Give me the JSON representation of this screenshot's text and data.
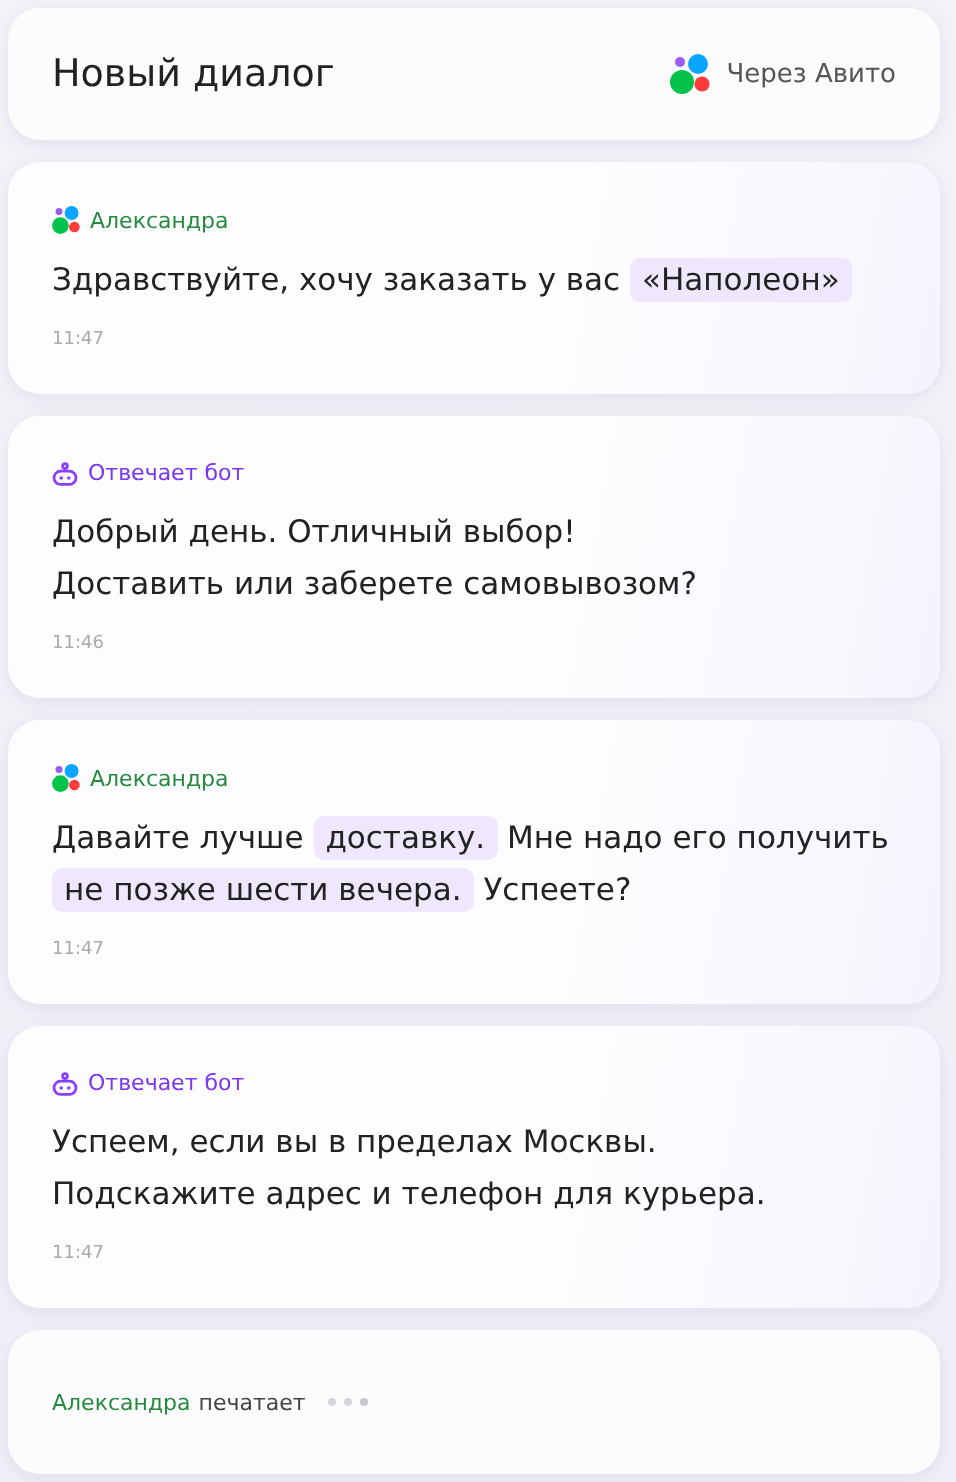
{
  "header": {
    "title": "Новый диалог",
    "channel": "Через Авито"
  },
  "messages": [
    {
      "sender": {
        "kind": "customer",
        "name": "Александра"
      },
      "lines": [
        [
          {
            "text": "Здравствуйте, хочу заказать у вас ",
            "highlighted": false
          },
          {
            "text": "«Наполеон»",
            "highlighted": true
          }
        ]
      ],
      "time": "11:47"
    },
    {
      "sender": {
        "kind": "bot",
        "name": "Отвечает бот"
      },
      "lines": [
        [
          {
            "text": "Добрый день. Отличный выбор!",
            "highlighted": false
          }
        ],
        [
          {
            "text": "Доставить или заберете самовывозом?",
            "highlighted": false
          }
        ]
      ],
      "time": "11:46"
    },
    {
      "sender": {
        "kind": "customer",
        "name": "Александра"
      },
      "lines": [
        [
          {
            "text": "Давайте лучше ",
            "highlighted": false
          },
          {
            "text": "доставку.",
            "highlighted": true
          },
          {
            "text": " Мне надо его получить",
            "highlighted": false
          }
        ],
        [
          {
            "text": "не позже шести вечера.",
            "highlighted": true
          },
          {
            "text": " Успеете?",
            "highlighted": false
          }
        ]
      ],
      "time": "11:47"
    },
    {
      "sender": {
        "kind": "bot",
        "name": "Отвечает бот"
      },
      "lines": [
        [
          {
            "text": "Успеем, если вы в пределах Москвы.",
            "highlighted": false
          }
        ],
        [
          {
            "text": "Подскажите адрес и телефон для курьера.",
            "highlighted": false
          }
        ]
      ],
      "time": "11:47"
    }
  ],
  "typing": {
    "name": "Александра",
    "status": "печатает"
  }
}
